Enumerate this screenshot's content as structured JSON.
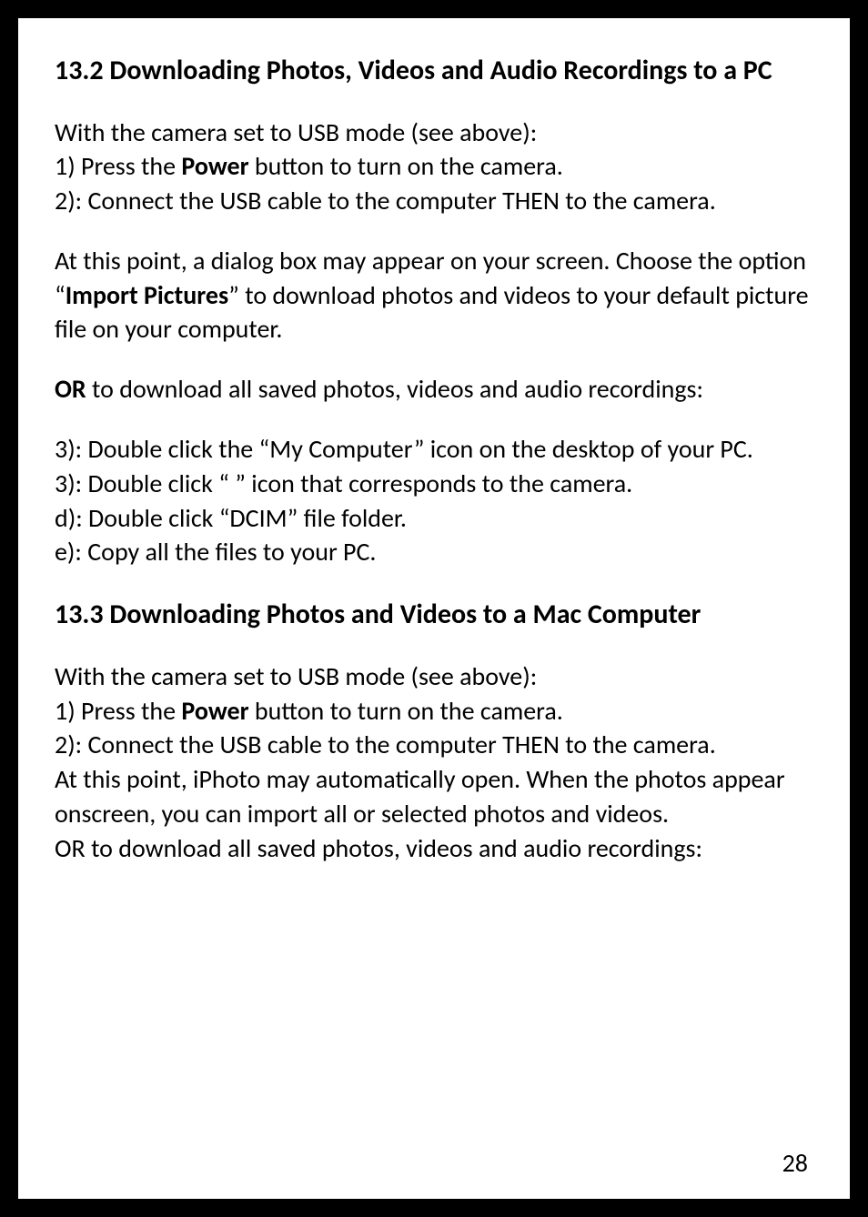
{
  "section1": {
    "heading": "13.2 Downloading Photos, Videos and Audio Recordings to a PC",
    "p1_line1": "With the camera set to USB mode (see above):",
    "p1_line2a": "1) Press the ",
    "p1_line2b": "Power",
    "p1_line2c": " button to turn on the camera.",
    "p1_line3": "2): Connect the USB cable to the computer THEN to the camera.",
    "p2a": "At this point, a dialog box may appear on your screen. Choose the option “",
    "p2b": "Import Pictures",
    "p2c": "” to download photos and videos to your default picture file on your computer.",
    "p3a": "OR",
    "p3b": " to download all saved photos, videos and audio recordings:",
    "p4_line1": "3): Double click the  “My Computer” icon on the desktop of your PC.",
    "p4_line2": "3): Double click “  ” icon that corresponds to the camera.",
    "p4_line3": "d): Double click “DCIM” file folder.",
    "p4_line4": "e): Copy all the files to your PC."
  },
  "section2": {
    "heading": "13.3 Downloading Photos and Videos to a Mac Computer",
    "p1_line1": "With the camera set to USB mode (see above):",
    "p1_line2a": "1) Press the ",
    "p1_line2b": "Power",
    "p1_line2c": " button to turn on the camera.",
    "p1_line3": "2): Connect the USB cable to the computer THEN to the camera.",
    "p1_line4": "At this point, iPhoto may automatically open. When the photos appear onscreen, you can import all or selected photos and videos.",
    "p1_line5": "OR to download all saved photos, videos and audio recordings:"
  },
  "pageNumber": "28"
}
